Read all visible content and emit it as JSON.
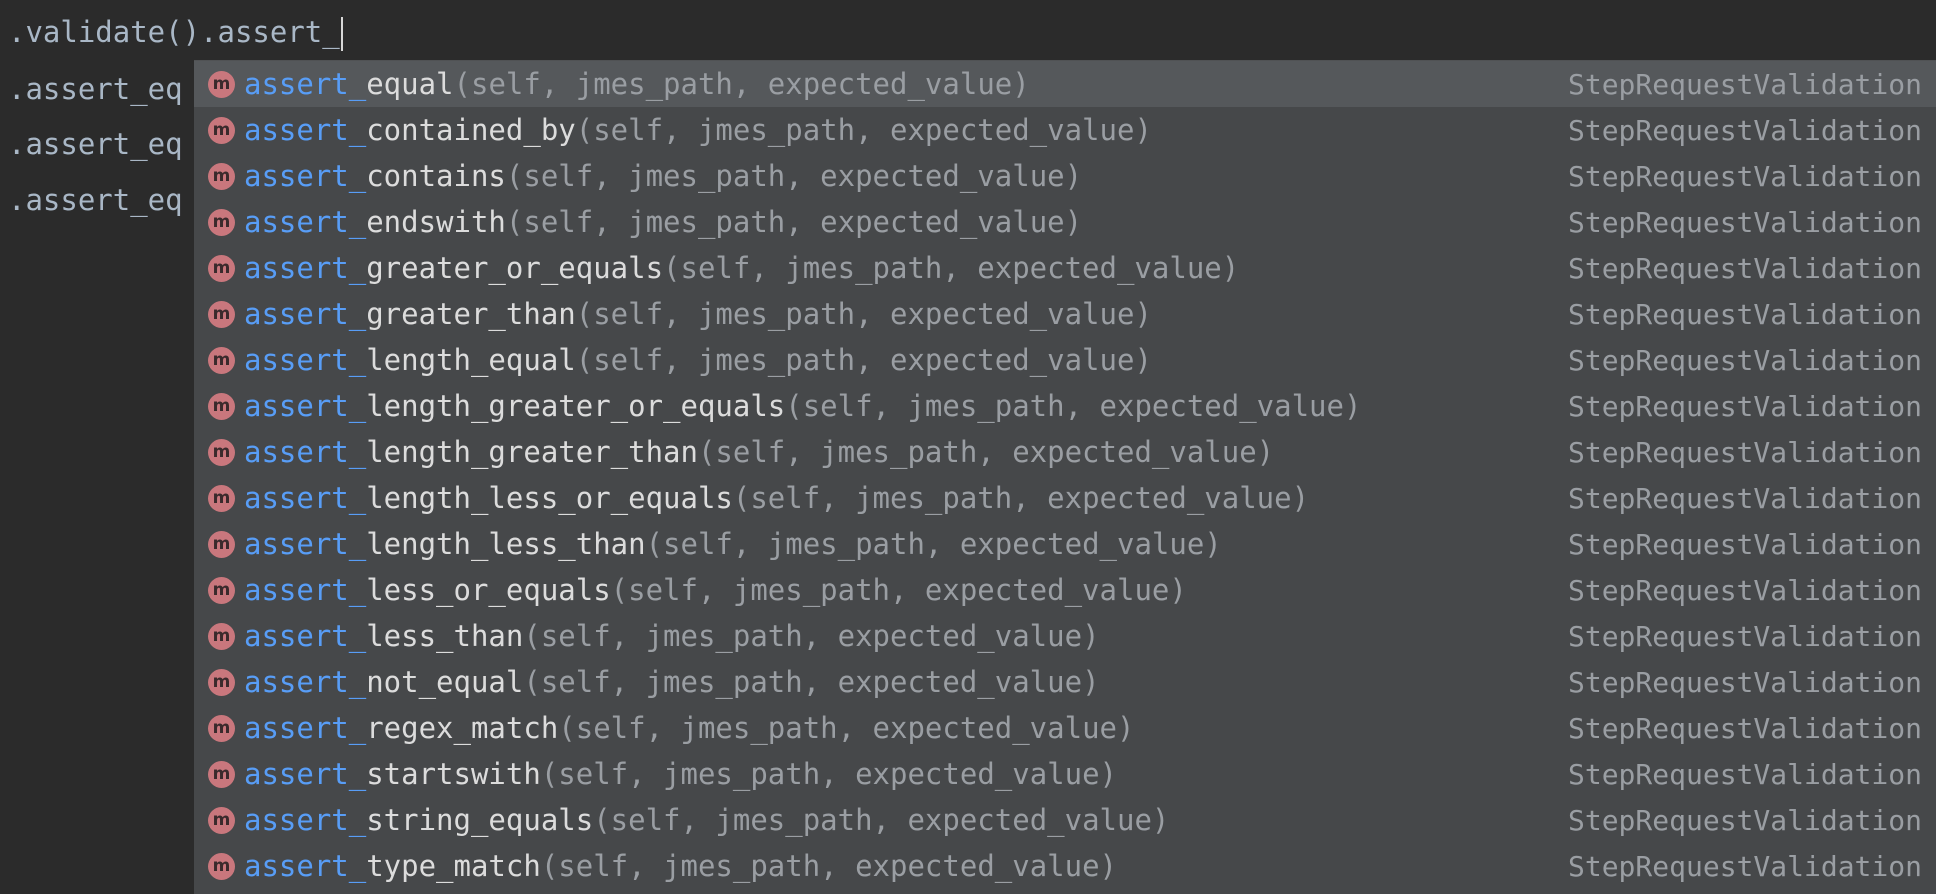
{
  "editor": {
    "current_line": ".validate().assert_",
    "above_lines": [
      ".assert_eq",
      ".assert_eq",
      ".assert_eq"
    ]
  },
  "completion": {
    "icon_letter": "m",
    "match_prefix": "assert_",
    "type_label": "StepRequestValidation",
    "items": [
      {
        "suffix": "equal",
        "params": "(self, jmes_path, expected_value)"
      },
      {
        "suffix": "contained_by",
        "params": "(self, jmes_path, expected_value)"
      },
      {
        "suffix": "contains",
        "params": "(self, jmes_path, expected_value)"
      },
      {
        "suffix": "endswith",
        "params": "(self, jmes_path, expected_value)"
      },
      {
        "suffix": "greater_or_equals",
        "params": "(self, jmes_path, expected_value)"
      },
      {
        "suffix": "greater_than",
        "params": "(self, jmes_path, expected_value)"
      },
      {
        "suffix": "length_equal",
        "params": "(self, jmes_path, expected_value)"
      },
      {
        "suffix": "length_greater_or_equals",
        "params": "(self, jmes_path, expected_value)"
      },
      {
        "suffix": "length_greater_than",
        "params": "(self, jmes_path, expected_value)"
      },
      {
        "suffix": "length_less_or_equals",
        "params": "(self, jmes_path, expected_value)"
      },
      {
        "suffix": "length_less_than",
        "params": "(self, jmes_path, expected_value)"
      },
      {
        "suffix": "less_or_equals",
        "params": "(self, jmes_path, expected_value)"
      },
      {
        "suffix": "less_than",
        "params": "(self, jmes_path, expected_value)"
      },
      {
        "suffix": "not_equal",
        "params": "(self, jmes_path, expected_value)"
      },
      {
        "suffix": "regex_match",
        "params": "(self, jmes_path, expected_value)"
      },
      {
        "suffix": "startswith",
        "params": "(self, jmes_path, expected_value)"
      },
      {
        "suffix": "string_equals",
        "params": "(self, jmes_path, expected_value)"
      },
      {
        "suffix": "type_match",
        "params": "(self, jmes_path, expected_value)"
      }
    ]
  }
}
